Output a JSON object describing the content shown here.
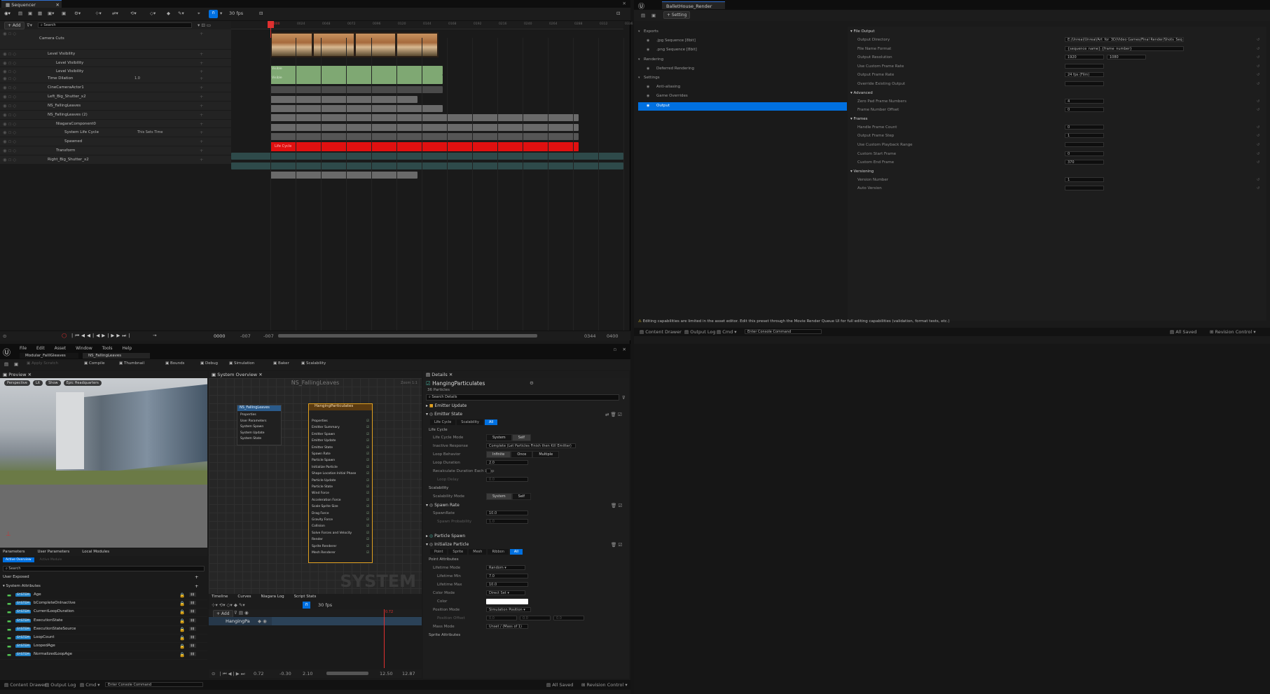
{
  "sequencer": {
    "tab": "Sequencer",
    "fps": "30 fps",
    "add": "+ Add",
    "search_placeholder": "Search",
    "current_frame": "0000",
    "tracks": [
      {
        "name": "Camera Cuts",
        "indent": 0
      },
      {
        "name": "Level Visibility",
        "indent": 1
      },
      {
        "name": "Level Visibility",
        "indent": 2
      },
      {
        "name": "Level Visibility",
        "indent": 2
      },
      {
        "name": "Time Dilation",
        "indent": 1,
        "value": "1.0"
      },
      {
        "name": "CineCameraActor1",
        "indent": 1
      },
      {
        "name": "Left_Big_Shutter_x2",
        "indent": 1
      },
      {
        "name": "NS_FallingLeaves",
        "indent": 1
      },
      {
        "name": "NS_FallingLeaves (2)",
        "indent": 1
      },
      {
        "name": "NiagaraComponent0",
        "indent": 2
      },
      {
        "name": "System Life Cycle",
        "indent": 3,
        "value": "This Sets Time"
      },
      {
        "name": "Spawned",
        "indent": 3
      },
      {
        "name": "Transform",
        "indent": 2
      },
      {
        "name": "Right_Big_Shutter_x2",
        "indent": 1
      }
    ],
    "ruler_ticks": [
      "0000",
      "0024",
      "0048",
      "0072",
      "0096",
      "0120",
      "0144",
      "0168",
      "0192",
      "0216",
      "0240",
      "0264",
      "0288",
      "0312",
      "0336"
    ],
    "life_cycle_label": "Life Cycle",
    "transport_time": "0000",
    "range_start": "-007",
    "range_start2": "-007",
    "range_end": "0344",
    "range_end2": "0400"
  },
  "mrq": {
    "tab": "BalletHouse_Render Pr...",
    "setting_button": "+ Setting",
    "tree": [
      {
        "label": "Exports",
        "level": 0
      },
      {
        "label": ".jpg Sequence [8bit]",
        "level": 1
      },
      {
        "label": ".png Sequence [8bit]",
        "level": 1
      },
      {
        "label": "Rendering",
        "level": 0
      },
      {
        "label": "Deferred Rendering",
        "level": 1
      },
      {
        "label": "Settings",
        "level": 0
      },
      {
        "label": "Anti-aliasing",
        "level": 1
      },
      {
        "label": "Game Overrides",
        "level": 1
      },
      {
        "label": "Output",
        "level": 1,
        "selected": true
      }
    ],
    "sections": [
      {
        "title": "File Output",
        "rows": [
          {
            "label": "Output Directory",
            "value": "E:/Unreal/Unreal/Art_for_3D/Video Games/Final Render/Shots_Seq_B"
          },
          {
            "label": "File Name Format",
            "value": "{sequence_name}.{frame_number}"
          },
          {
            "label": "Output Resolution",
            "value": "1920",
            "value2": "1080"
          },
          {
            "label": "Use Custom Frame Rate",
            "value": ""
          },
          {
            "label": "Output Frame Rate",
            "value": "24 fps (Film)"
          },
          {
            "label": "Override Existing Output",
            "value": ""
          }
        ]
      },
      {
        "title": "Advanced",
        "rows": [
          {
            "label": "Zero Pad Frame Numbers",
            "value": "4"
          },
          {
            "label": "Frame Number Offset",
            "value": "0"
          }
        ]
      },
      {
        "title": "Frames",
        "rows": [
          {
            "label": "Handle Frame Count",
            "value": "0"
          },
          {
            "label": "Output Frame Step",
            "value": "1"
          },
          {
            "label": "Use Custom Playback Range",
            "value": ""
          },
          {
            "label": "Custom Start Frame",
            "value": "0"
          },
          {
            "label": "Custom End Frame",
            "value": "370"
          }
        ]
      },
      {
        "title": "Versioning",
        "rows": [
          {
            "label": "Version Number",
            "value": "1"
          },
          {
            "label": "Auto Version",
            "value": ""
          }
        ]
      }
    ],
    "warning": "Editing capabilities are limited in the asset editor. Edit this preset through the Movie Render Queue UI for full editing capabilities (validation, format tests, etc.)",
    "content_drawer": "Content Drawer",
    "output_log": "Output Log",
    "cmd": "Cmd",
    "console_placeholder": "Enter Console Command",
    "all_saved": "All Saved",
    "revision_control": "Revision Control"
  },
  "niagara": {
    "menu": [
      "File",
      "Edit",
      "Asset",
      "Window",
      "Tools",
      "Help"
    ],
    "tabs": [
      "Modular_FallIGleaves",
      "NS_FallingLeaves"
    ],
    "toolbar": [
      "Apply Scratch",
      "Compile",
      "Thumbnail",
      "Bounds",
      "Debug",
      "Simulation",
      "Baker",
      "Scalability"
    ],
    "preview_tab": "Preview",
    "viewport_buttons": [
      "Perspective",
      "Lit",
      "Show",
      "Epic Headquarters"
    ],
    "overview_tab": "System Overview",
    "graph_title": "NS_FallingLeaves",
    "zoom": "Zoom 1:1",
    "watermark": "SYSTEM",
    "system_node": {
      "title": "NS_FallingLeaves",
      "items": [
        "Properties",
        "User Parameters",
        "System Spawn",
        "System Update",
        "System State"
      ]
    },
    "emitter_node": {
      "title": "HangingParticulates",
      "items": [
        "Properties",
        "Emitter Summary",
        "Emitter Spawn",
        "Emitter Update",
        "Emitter State",
        "Spawn Rate",
        "Particle Spawn",
        "Initialize Particle",
        "Shape Location Initial Phase",
        "Particle Update",
        "Particle State",
        "Wind Force",
        "Acceleration Force",
        "Scale Sprite Size",
        "Drag Force",
        "Gravity Force",
        "Collision",
        "Solve Forces and Velocity",
        "Render",
        "Sprite Renderer",
        "Mesh Renderer"
      ]
    },
    "details_tab": "Details",
    "details_title": "HangingParticulates",
    "details_sub": "36 Particles",
    "details_search": "Search Details",
    "params_tabs": [
      "Parameters",
      "User Parameters",
      "Local Modules"
    ],
    "params_sub_tabs": [
      "Active Overview",
      "Active Module"
    ],
    "params_search": "Search",
    "user_exposed": "User Exposed",
    "system_attributes": "System Attributes",
    "attrs": [
      {
        "tag": "SYSTEM",
        "name": "Age"
      },
      {
        "tag": "SYSTEM",
        "name": "bCompleteOnInactive"
      },
      {
        "tag": "SYSTEM",
        "name": "CurrentLoopDuration"
      },
      {
        "tag": "SYSTEM",
        "name": "ExecutionState"
      },
      {
        "tag": "SYSTEM",
        "name": "ExecutionStateSource"
      },
      {
        "tag": "SYSTEM",
        "name": "LoopCount"
      },
      {
        "tag": "SYSTEM",
        "name": "LoopedAge"
      },
      {
        "tag": "SYSTEM",
        "name": "NormalizedLoopAge"
      }
    ],
    "timeline_tabs": [
      "Timeline",
      "Curves",
      "Niagara Log",
      "Script Stats"
    ],
    "timeline_fps": "30 fps",
    "timeline_add": "+ Add",
    "timeline_track": "HangingPa",
    "timeline_time": "0.72",
    "timeline_start": "-0.30",
    "timeline_start2": "2.10",
    "timeline_end": "12.50",
    "timeline_end2": "12.87",
    "timeline_current": "0.72",
    "details": {
      "emitter_update": "Emitter Update",
      "emitter_state": "Emitter State",
      "filters": [
        "Life Cycle",
        "Scalability",
        "All"
      ],
      "life_cycle": "Life Cycle",
      "life_cycle_mode_label": "Life Cycle Mode",
      "life_cycle_mode": [
        "System",
        "Self"
      ],
      "inactive_response_label": "Inactive Response",
      "inactive_response": "Complete (Let Particles Finish then Kill Emitter)",
      "loop_behavior_label": "Loop Behavior",
      "loop_behavior": [
        "Infinite",
        "Once",
        "Multiple"
      ],
      "loop_duration_label": "Loop Duration",
      "loop_duration": "2.0",
      "recalc_label": "Recalculate Duration Each Loop",
      "loop_delay_label": "Loop Delay",
      "loop_delay": "0.0",
      "scalability": "Scalability",
      "scalability_mode_label": "Scalability Mode",
      "scalability_mode": [
        "System",
        "Self"
      ],
      "spawn_rate": "Spawn Rate",
      "spawn_rate_label": "SpawnRate",
      "spawn_rate_value": "10.0",
      "spawn_probability_label": "Spawn Probability",
      "spawn_probability": "1.0",
      "particle_spawn": "Particle Spawn",
      "initialize_particle": "Initialize Particle",
      "init_filters": [
        "Point",
        "Sprite",
        "Mesh",
        "Ribbon",
        "All"
      ],
      "point_attributes": "Point Attributes",
      "lifetime_mode_label": "Lifetime Mode",
      "lifetime_mode": "Random",
      "lifetime_min_label": "Lifetime Min",
      "lifetime_min": "7.0",
      "lifetime_max_label": "Lifetime Max",
      "lifetime_max": "10.0",
      "color_mode_label": "Color Mode",
      "color_mode": "Direct Set",
      "color_label": "Color",
      "position_mode_label": "Position Mode",
      "position_mode": "Simulation Position",
      "position_offset_label": "Position Offset",
      "position_offset": [
        "0.0",
        "0.0",
        "0.0"
      ],
      "mass_mode_label": "Mass Mode",
      "mass_mode": "Unset / (Mass of 1)",
      "sprite_attributes": "Sprite Attributes"
    },
    "content_drawer": "Content Drawer",
    "output_log": "Output Log",
    "cmd": "Cmd",
    "console_placeholder": "Enter Console Command",
    "all_saved": "All Saved",
    "revision_control": "Revision Control"
  },
  "colors": {
    "accent": "#0070e0",
    "track_green": "#7fa873",
    "track_red": "#e01010",
    "track_gray": "#6a6a6a"
  }
}
